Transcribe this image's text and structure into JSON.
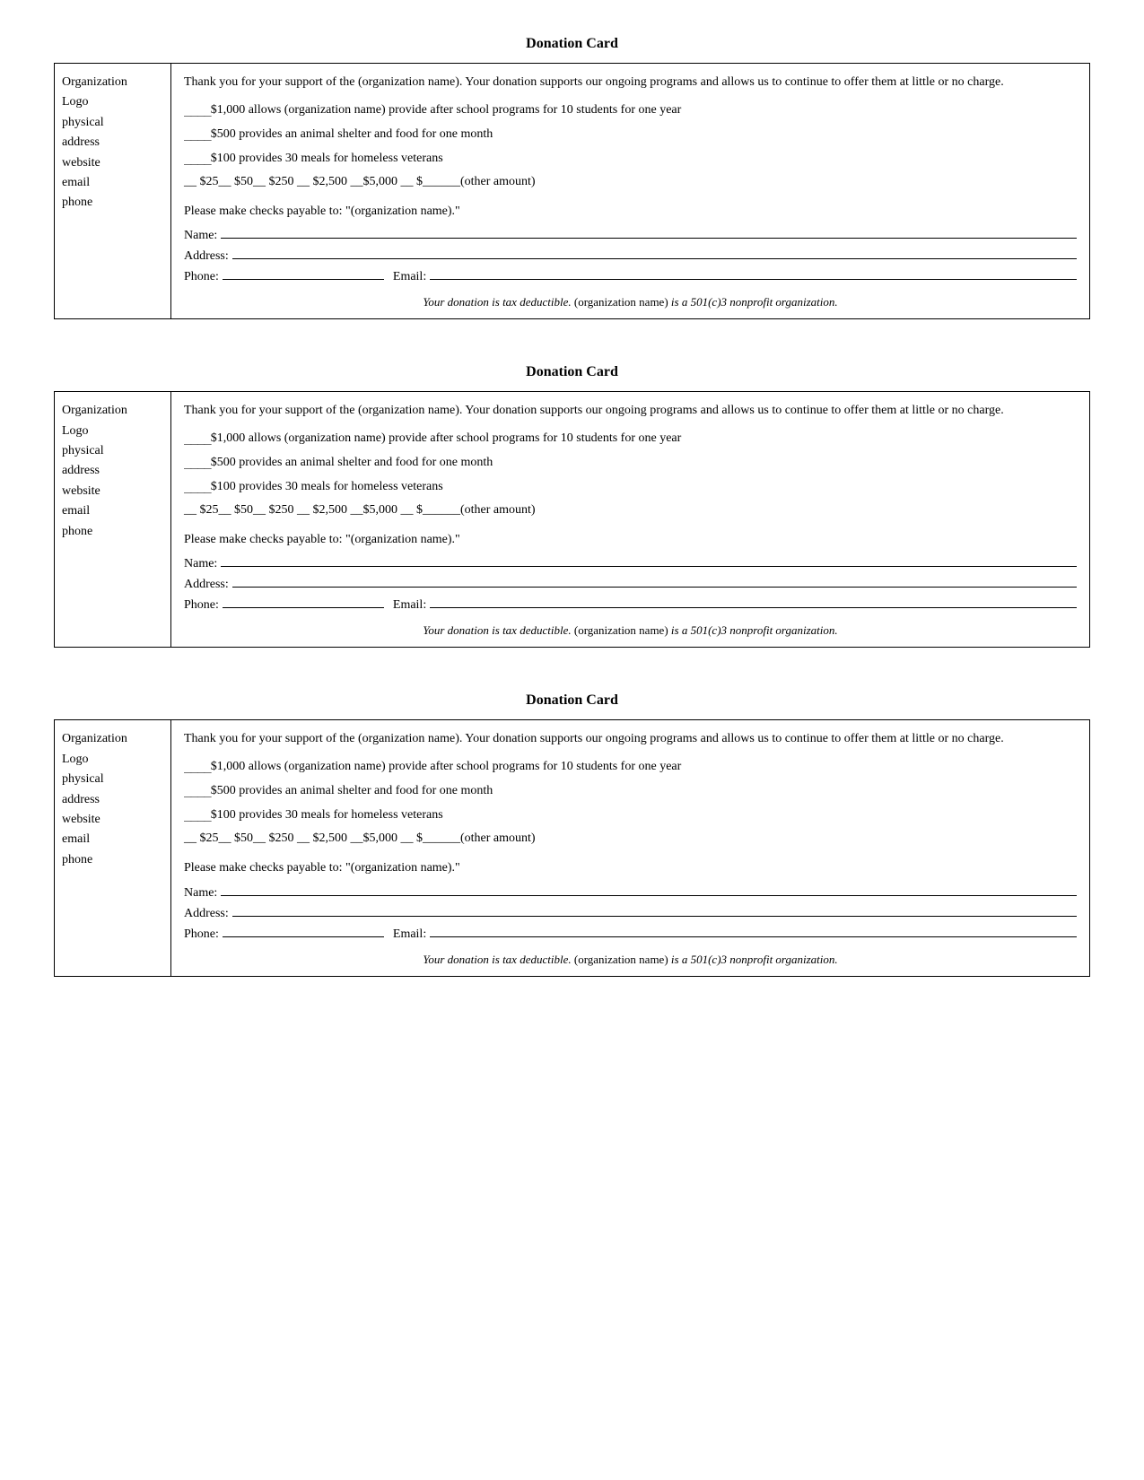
{
  "cards": [
    {
      "id": "card-1",
      "title": "Donation Card",
      "org_logo": {
        "line1": "Organization",
        "line2": "Logo",
        "line3": "physical",
        "line4": "address",
        "line5": "website",
        "line6": "email",
        "line7": "phone"
      },
      "intro": "Thank you for your support of the (organization name).  Your donation supports our ongoing programs and allows us to continue to offer them at little or no charge.",
      "donation_lines": [
        "$1,000 allows (organization name) provide after school programs for 10 students for one year",
        "$500 provides an animal shelter and food for one month",
        "$100 provides 30 meals for homeless veterans"
      ],
      "amounts": "__ $25__ $50__ $250 __ $2,500 __$5,000     __ $______(other amount)",
      "checks_payable": "Please make checks payable to: \"(organization name).\"",
      "fields": {
        "name_label": "Name:",
        "address_label": "Address:",
        "phone_label": "Phone:",
        "email_label": "Email:"
      },
      "tax_note_italic": "Your donation is tax deductible.",
      "tax_note_org": "(organization name)",
      "tax_note_italic2": "is a 501(c)3 nonprofit organization."
    },
    {
      "id": "card-2",
      "title": "Donation Card",
      "org_logo": {
        "line1": "Organization",
        "line2": "Logo",
        "line3": "physical",
        "line4": "address",
        "line5": "website",
        "line6": "email",
        "line7": "phone"
      },
      "intro": "Thank you for your support of the (organization name).  Your donation supports our ongoing programs and allows us to continue to offer them at little or no charge.",
      "donation_lines": [
        "$1,000 allows (organization name) provide after school programs for 10 students for one year",
        "$500 provides an animal shelter and food for one month",
        "$100 provides 30 meals for homeless veterans"
      ],
      "amounts": "__ $25__ $50__ $250 __ $2,500 __$5,000     __ $______(other amount)",
      "checks_payable": "Please make checks payable to: \"(organization name).\"",
      "fields": {
        "name_label": "Name:",
        "address_label": "Address:",
        "phone_label": "Phone:",
        "email_label": "Email:"
      },
      "tax_note_italic": "Your donation is tax deductible.",
      "tax_note_org": "(organization name)",
      "tax_note_italic2": "is a 501(c)3 nonprofit organization."
    },
    {
      "id": "card-3",
      "title": "Donation Card",
      "org_logo": {
        "line1": "Organization",
        "line2": "Logo",
        "line3": "physical",
        "line4": "address",
        "line5": "website",
        "line6": "email",
        "line7": "phone"
      },
      "intro": "Thank you for your support of the (organization name).  Your donation supports our ongoing programs and allows us to continue to offer them at little or no charge.",
      "donation_lines": [
        "$1,000 allows (organization name) provide after school programs for 10 students for one year",
        "$500 provides an animal shelter and food for one month",
        "$100 provides 30 meals for homeless veterans"
      ],
      "amounts": "__ $25__ $50__ $250 __ $2,500 __$5,000     __ $______(other amount)",
      "checks_payable": "Please make checks payable to: \"(organization name).\"",
      "fields": {
        "name_label": "Name:",
        "address_label": "Address:",
        "phone_label": "Phone:",
        "email_label": "Email:"
      },
      "tax_note_italic": "Your donation is tax deductible.",
      "tax_note_org": "(organization name)",
      "tax_note_italic2": "is a 501(c)3 nonprofit organization."
    }
  ]
}
